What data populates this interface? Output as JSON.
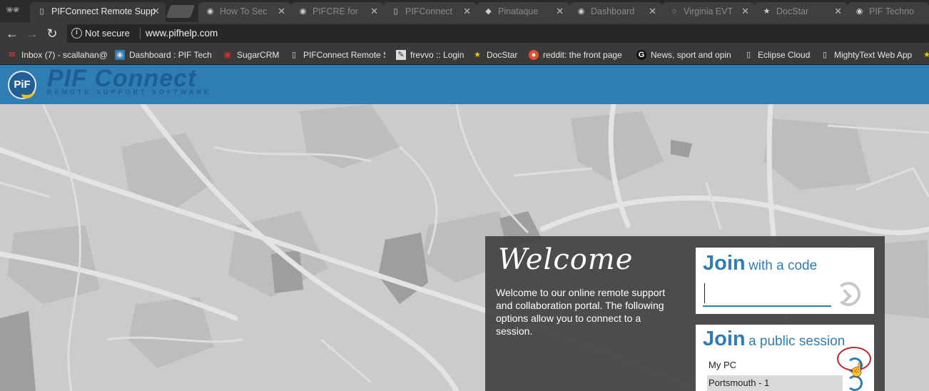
{
  "browser": {
    "tabs": [
      {
        "label": "PIFConnect Remote Supp",
        "active": true
      },
      {
        "label": "How To Sec",
        "active": false
      },
      {
        "label": "PIFCRE for",
        "active": false
      },
      {
        "label": "PIFConnect",
        "active": false
      },
      {
        "label": "Pinataque",
        "active": false
      },
      {
        "label": "Dashboard",
        "active": false
      },
      {
        "label": "Virginia EVT",
        "active": false
      },
      {
        "label": "DocStar",
        "active": false
      },
      {
        "label": "PIF Techno",
        "active": false
      }
    ],
    "close_glyph": "✕",
    "security_label": "Not secure",
    "url": "www.pifhelp.com"
  },
  "bookmarks": [
    {
      "label": "Inbox (7) - scallahan@",
      "icon": "gmail-icon"
    },
    {
      "label": "Dashboard : PIF Tech",
      "icon": "pif-icon"
    },
    {
      "label": "SugarCRM",
      "icon": "sugarcrm-icon"
    },
    {
      "label": "PIFConnect Remote S",
      "icon": "page-icon"
    },
    {
      "label": "frevvo :: Login",
      "icon": "frevvo-icon"
    },
    {
      "label": "DocStar",
      "icon": "star-icon"
    },
    {
      "label": "reddit: the front page",
      "icon": "reddit-icon"
    },
    {
      "label": "News, sport and opin",
      "icon": "guardian-icon"
    },
    {
      "label": "Eclipse Cloud",
      "icon": "page-icon"
    },
    {
      "label": "MightyText Web App",
      "icon": "page-icon"
    }
  ],
  "site": {
    "logo_mark": "PiF",
    "logo_text": "PIF Connect",
    "logo_subtitle": "REMOTE SUPPORT SOFTWARE"
  },
  "welcome": {
    "title": "Welcome",
    "body": "Welcome to our online remote support and collaboration portal. The following options allow you to connect to a session."
  },
  "join_code": {
    "title_strong": "Join",
    "title_light": "with a code",
    "value": ""
  },
  "join_public": {
    "title_strong": "Join",
    "title_light": "a public session",
    "sessions": [
      {
        "label": "My PC"
      },
      {
        "label": "Portsmouth - 1"
      }
    ]
  },
  "colors": {
    "accent": "#2f7db5",
    "panel": "#444444",
    "highlight": "#c0272d"
  }
}
